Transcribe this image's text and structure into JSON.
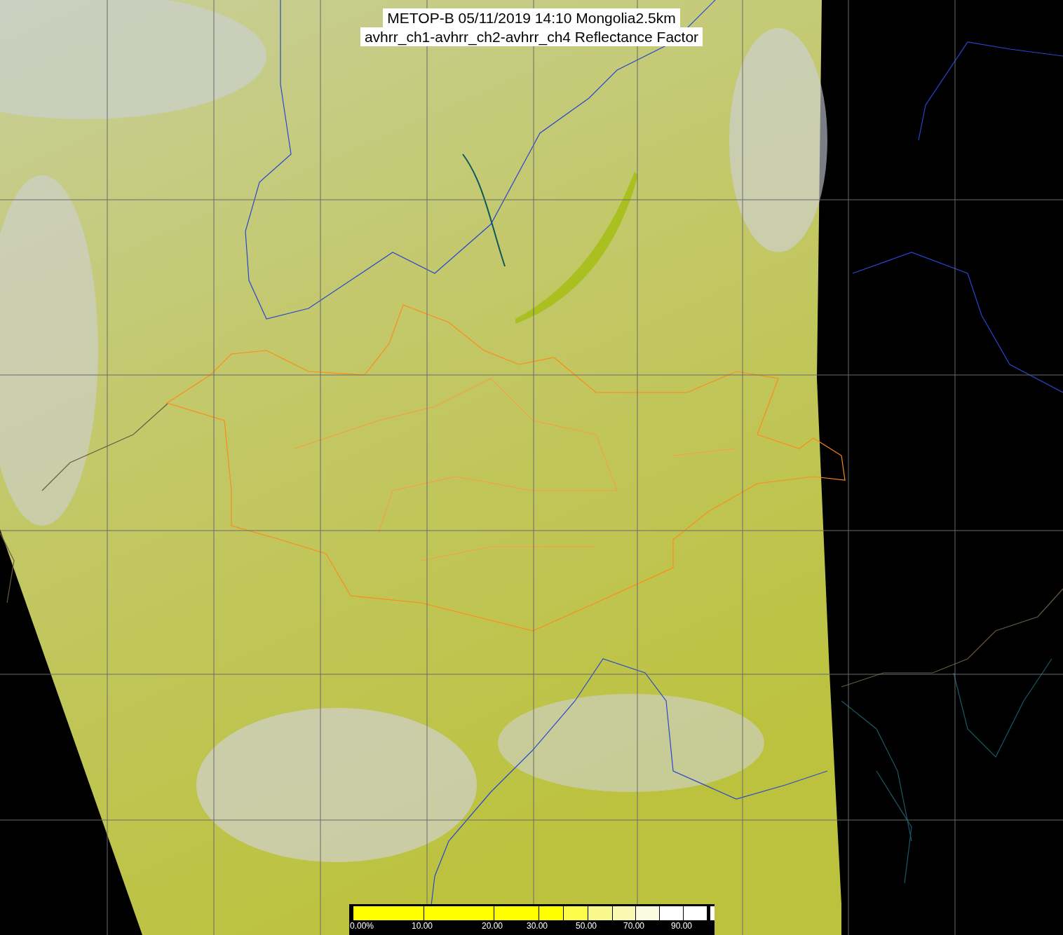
{
  "title": {
    "lines": [
      "METOP-B 05/11/2019 14:10 Mongolia2.5km",
      "avhrr_ch1-avhrr_ch2-avhrr_ch4 Reflectance Factor"
    ]
  },
  "colorbar": {
    "segments": [
      {
        "label": "0.00%",
        "color": "#ffff00"
      },
      {
        "label": "10.00",
        "color": "#ffff00"
      },
      {
        "label": "20.00",
        "color": "#ffff00"
      },
      {
        "label": "30.00",
        "color": "#ffff00"
      },
      {
        "color": "#fbfb4a"
      },
      {
        "label": "50.00",
        "color": "#f8f88c"
      },
      {
        "color": "#f9f9b4"
      },
      {
        "label": "70.00",
        "color": "#fbfbe2"
      },
      {
        "color": "#ffffff"
      },
      {
        "label": "90.00",
        "color": "#ffffff"
      }
    ]
  }
}
